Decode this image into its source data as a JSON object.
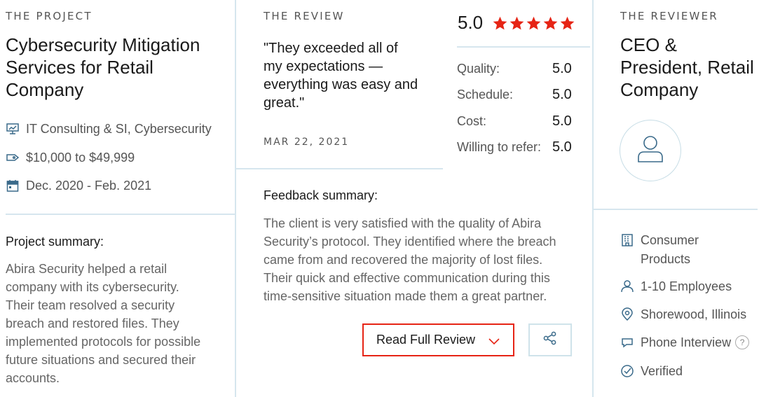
{
  "project": {
    "eyebrow": "THE PROJECT",
    "title_lines": [
      "Cybersecurity Mitigation",
      "Services for Retail",
      "Company"
    ],
    "meta": {
      "services": "IT Consulting & SI, Cybersecurity",
      "budget": "$10,000 to $49,999",
      "dates": "Dec. 2020 - Feb. 2021"
    },
    "summary_label": "Project summary:",
    "summary_lines": [
      "Abira Security helped a retail",
      "company with its cybersecurity.",
      "Their team resolved a security",
      "breach and restored files. They",
      "implemented protocols for possible",
      "future situations and secured their",
      "accounts."
    ]
  },
  "review": {
    "eyebrow": "THE REVIEW",
    "quote_lines": [
      "\"They exceeded all of",
      "my expectations —",
      "everything was easy and",
      "great.\""
    ],
    "date": "MAR 22, 2021",
    "overall": "5.0",
    "stars": 5,
    "ratings": [
      {
        "label": "Quality:",
        "value": "5.0"
      },
      {
        "label": "Schedule:",
        "value": "5.0"
      },
      {
        "label": "Cost:",
        "value": "5.0"
      },
      {
        "label": "Willing to refer:",
        "value": "5.0"
      }
    ],
    "feedback_label": "Feedback summary:",
    "feedback_lines": [
      "The client is very satisfied with the quality of Abira",
      "Security’s protocol. They identified where the breach",
      "came from and recovered the majority of lost files.",
      "Their quick and effective communication during this",
      "time-sensitive situation made them a great partner."
    ],
    "read_full_label": "Read Full Review"
  },
  "reviewer": {
    "eyebrow": "THE REVIEWER",
    "title_lines": [
      "CEO &",
      "President, Retail",
      "Company"
    ],
    "industry_lines": [
      "Consumer",
      "Products"
    ],
    "employees": "1-10 Employees",
    "location": "Shorewood, Illinois",
    "interview": "Phone Interview",
    "help_glyph": "?",
    "verified": "Verified"
  },
  "colors": {
    "star": "#e62415",
    "accent_border": "#e62415",
    "divider": "#d6e6ee",
    "icon": "#3a6a8a"
  },
  "icons": {
    "services": "presentation-chart-icon",
    "budget": "price-tag-icon",
    "dates": "calendar-icon",
    "industry": "building-icon",
    "employees": "user-icon",
    "location": "location-pin-icon",
    "interview": "chat-bubble-icon",
    "verified": "check-circle-icon",
    "share": "share-icon",
    "chevron": "chevron-down-icon"
  }
}
